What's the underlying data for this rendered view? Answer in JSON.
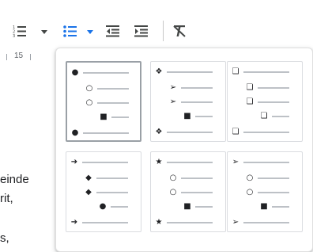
{
  "toolbar": {
    "buttons": [
      {
        "name": "numbered-list-icon"
      },
      {
        "name": "numbered-list-dropdown-icon"
      },
      {
        "name": "bulleted-list-icon"
      },
      {
        "name": "bulleted-list-dropdown-icon"
      },
      {
        "name": "decrease-indent-icon"
      },
      {
        "name": "increase-indent-icon"
      },
      {
        "name": "clear-formatting-icon"
      }
    ],
    "accent": "#1a73e8"
  },
  "ruler": {
    "label": "15"
  },
  "doc": {
    "lines": [
      "einde",
      "rit,",
      "s,"
    ]
  },
  "bullet_menu": {
    "selected_index": 0,
    "presets": [
      {
        "glyphs": [
          "●",
          "○",
          "○",
          "■",
          "●"
        ]
      },
      {
        "glyphs": [
          "❖",
          "➢",
          "➢",
          "■",
          "❖"
        ]
      },
      {
        "glyphs": [
          "❏",
          "❏",
          "❏",
          "❏",
          "❏"
        ]
      },
      {
        "glyphs": [
          "➔",
          "◆",
          "◆",
          "●",
          "➔"
        ]
      },
      {
        "glyphs": [
          "★",
          "○",
          "○",
          "■",
          "★"
        ]
      },
      {
        "glyphs": [
          "➢",
          "○",
          "○",
          "■",
          "➢"
        ]
      }
    ]
  }
}
